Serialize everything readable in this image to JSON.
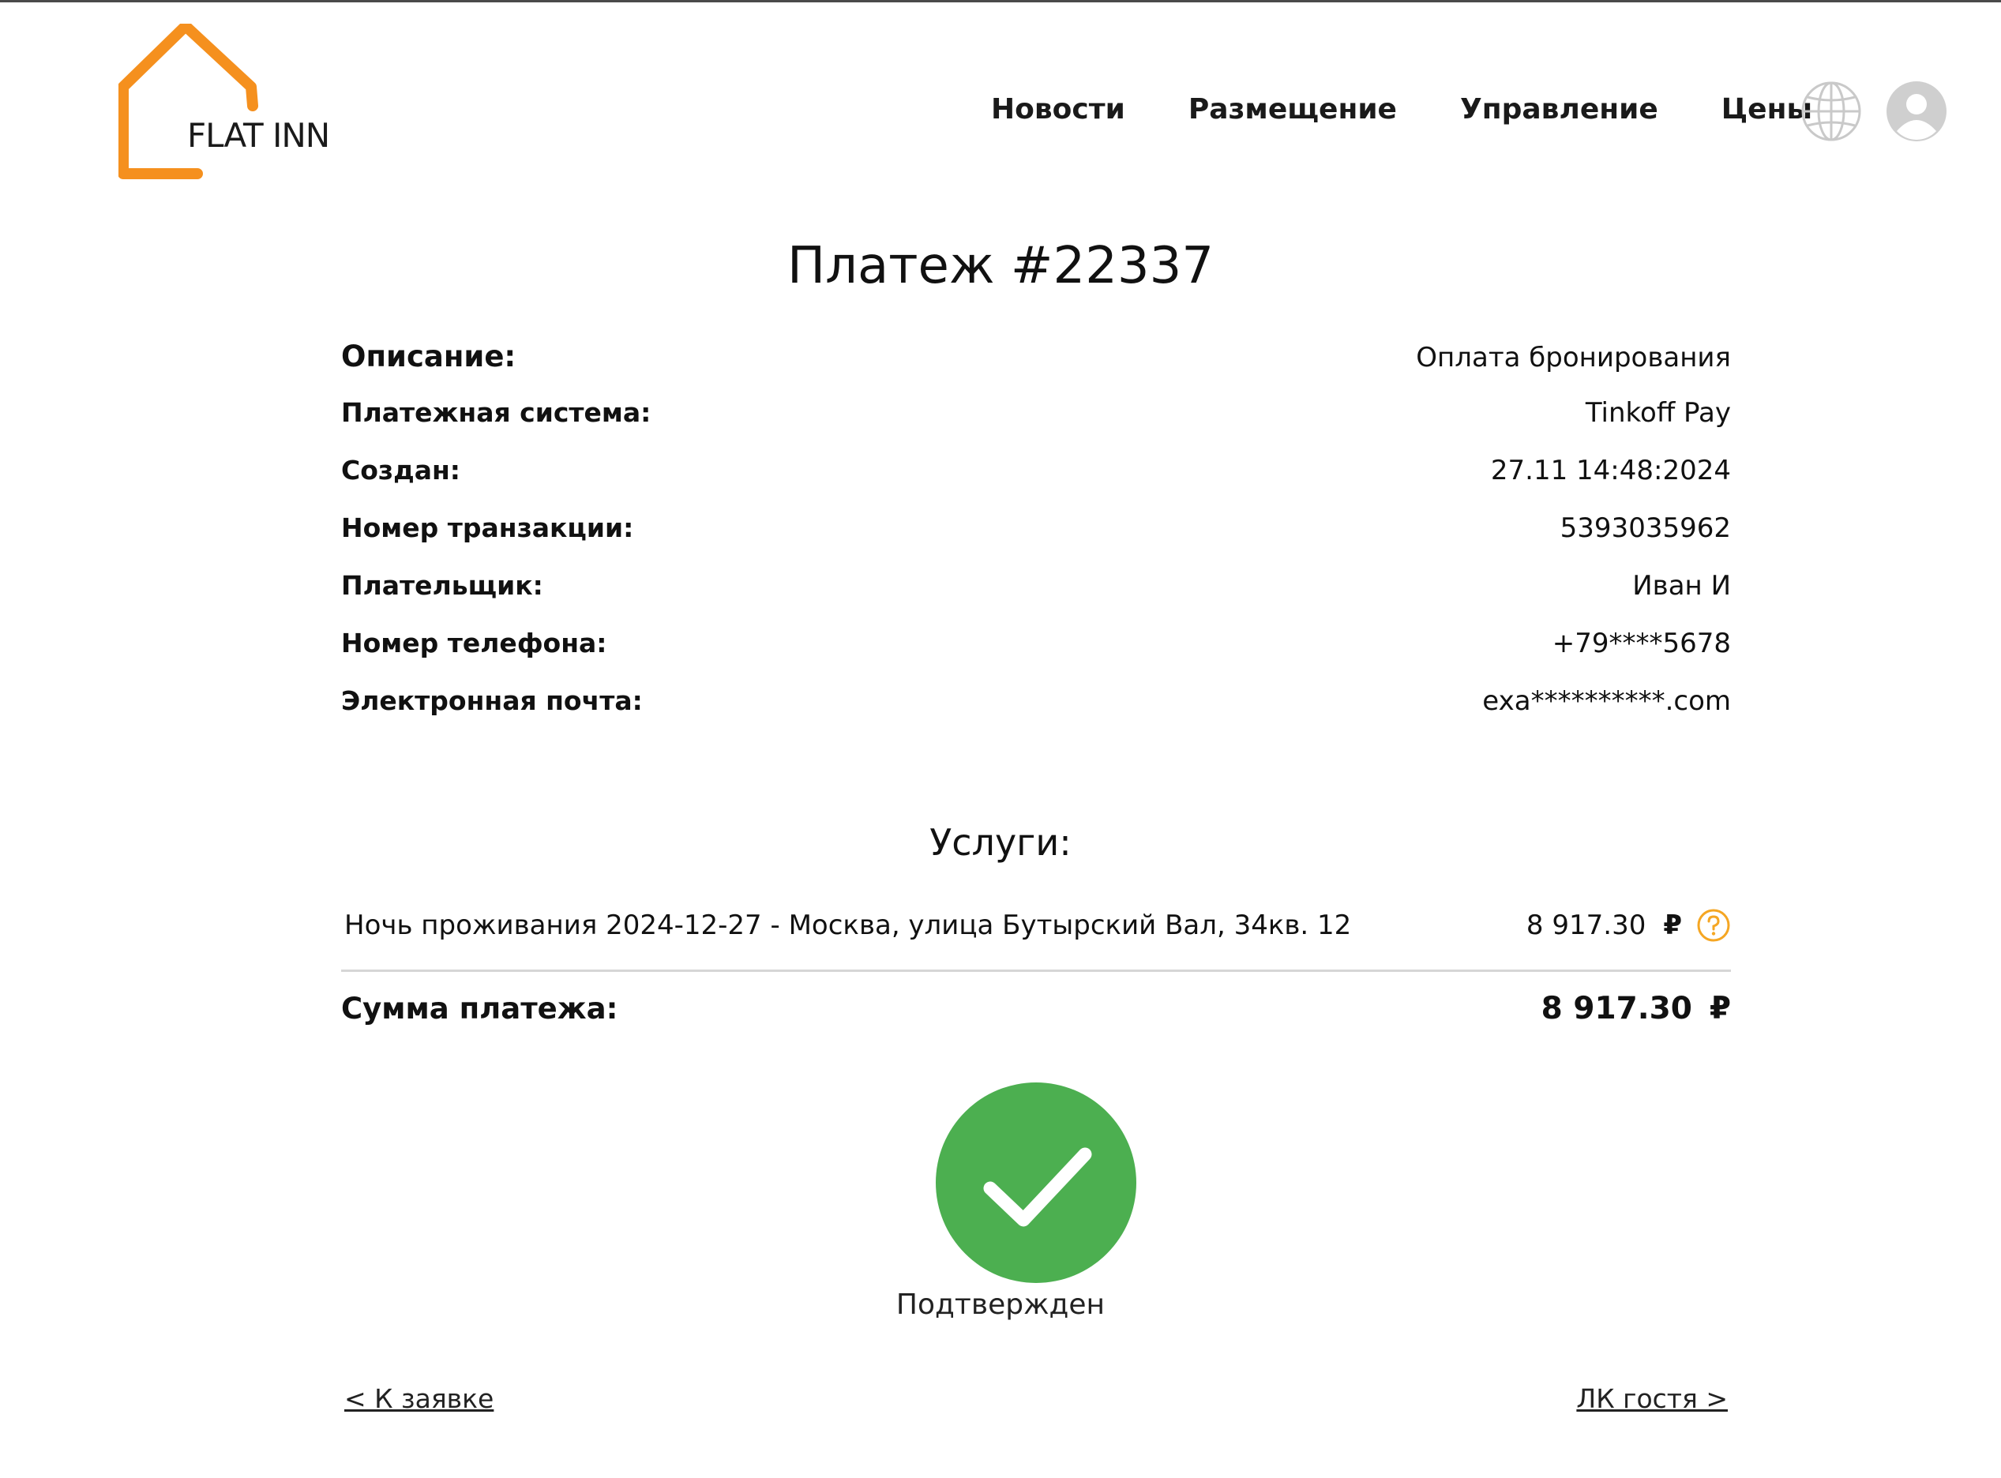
{
  "header": {
    "logo_text": "FLAT INN",
    "nav": [
      {
        "label": "Новости"
      },
      {
        "label": "Размещение"
      },
      {
        "label": "Управление"
      },
      {
        "label": "Цены"
      }
    ],
    "icons": [
      "globe-icon",
      "user-avatar-icon"
    ]
  },
  "payment": {
    "title": "Платеж #22337",
    "details": [
      {
        "label": "Описание:",
        "value": "Оплата бронирования"
      },
      {
        "label": "Платежная система:",
        "value": "Tinkoff Pay"
      },
      {
        "label": "Создан:",
        "value": "27.11 14:48:2024"
      },
      {
        "label": "Номер транзакции:",
        "value": "5393035962"
      },
      {
        "label": "Плательщик:",
        "value": "Иван И"
      },
      {
        "label": "Номер телефона:",
        "value": "+79****5678"
      },
      {
        "label": "Электронная почта:",
        "value": "exa**********.com"
      }
    ]
  },
  "services": {
    "title": "Услуги:",
    "items": [
      {
        "description": "Ночь проживания 2024-12-27 - Москва, улица Бутырский Вал, 34кв. 12",
        "price": "8 917.30",
        "currency": "₽"
      }
    ]
  },
  "total": {
    "label": "Сумма платежа:",
    "value": "8 917.30",
    "currency": "₽"
  },
  "status": {
    "text": "Подтвержден",
    "color": "#4caf50"
  },
  "links": {
    "back": "< К заявке",
    "guest": "ЛК гостя >"
  },
  "colors": {
    "brand": "#f5901e",
    "success": "#4caf50",
    "help": "#f5a623"
  }
}
